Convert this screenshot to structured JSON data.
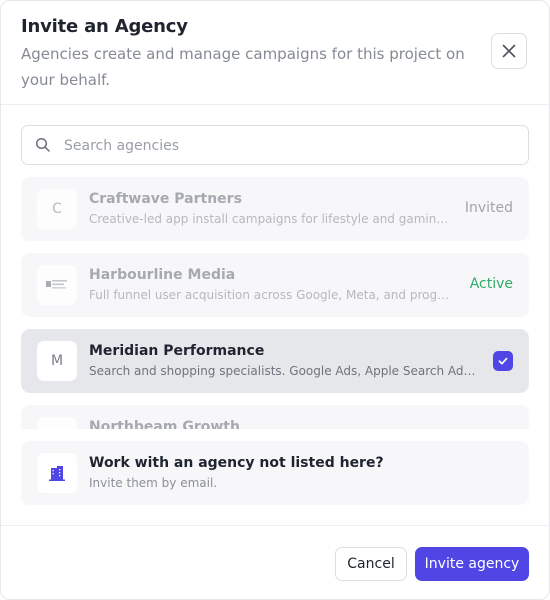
{
  "dialog": {
    "title": "Invite an Agency",
    "subtitle": "Agencies create and manage campaigns for this project on your behalf."
  },
  "search": {
    "placeholder": "Search agencies",
    "value": ""
  },
  "agencies": [
    {
      "initial": "C",
      "name": "Craftwave Partners",
      "description": "Creative-led app install campaigns for lifestyle and gaming brands.",
      "status": "Invited",
      "selected": false
    },
    {
      "initial": "",
      "name": "Harbourline Media",
      "description": "Full funnel user acquisition across Google, Meta, and programmatic networks.",
      "status": "Active",
      "selected": false
    },
    {
      "initial": "M",
      "name": "Meridian Performance",
      "description": "Search and shopping specialists. Google Ads, Apple Search Ads, and more.",
      "status": "",
      "selected": true
    },
    {
      "initial": "",
      "name": "Northbeam Growth",
      "description": "",
      "status": "",
      "selected": false
    }
  ],
  "unlisted": {
    "title": "Work with an agency not listed here?",
    "subtitle": "Invite them by email."
  },
  "footer": {
    "cancel_label": "Cancel",
    "invite_label": "Invite agency"
  },
  "colors": {
    "accent": "#4f46e5",
    "active_status": "#2fae66",
    "selected_row": "#e6e7ea"
  }
}
